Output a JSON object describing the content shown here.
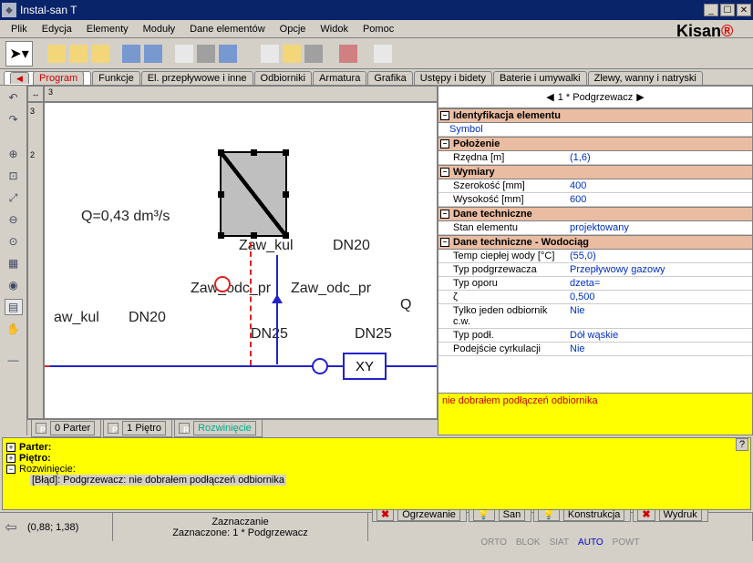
{
  "titlebar": {
    "title": "Instal-san T"
  },
  "menu": {
    "plik": "Plik",
    "edycja": "Edycja",
    "elementy": "Elementy",
    "moduly": "Moduły",
    "dane": "Dane elementów",
    "opcje": "Opcje",
    "widok": "Widok",
    "pomoc": "Pomoc"
  },
  "brand": "Kisan",
  "toptabs": {
    "program": "Program",
    "funkcje": "Funkcje",
    "elprzep": "El. przepływowe i inne",
    "odb": "Odbiorniki",
    "arm": "Armatura",
    "graf": "Grafika",
    "ustepy": "Ustępy i bidety",
    "baterie": "Baterie i umywalki",
    "zlewy": "Zlewy, wanny i natryski"
  },
  "canvas": {
    "q": "Q=0,43 dm³/s",
    "zaw_kul": "Zaw_kul",
    "dn20": "DN20",
    "aw_kul": "aw_kul",
    "zaw_odc_pr": "Zaw_odc_pr",
    "Zw_odc_pr": "Zaw_odc_pr",
    "dn25": "DN25",
    "Q": "Q",
    "xy": "XY",
    "ruler3": "3",
    "ruler2": "2"
  },
  "bottomtabs": {
    "t0": "0 Parter",
    "t1": "1 Piętro",
    "t2": "Rozwinięcie"
  },
  "prop": {
    "header": "1 * Podgrzewacz",
    "g1": "Identyfikacja elementu",
    "symbol": "Symbol",
    "g2": "Położenie",
    "rzedna_k": "Rzędna [m]",
    "rzedna_v": "(1,6)",
    "g3": "Wymiary",
    "szer_k": "Szerokość [mm]",
    "szer_v": "400",
    "wys_k": "Wysokość [mm]",
    "wys_v": "600",
    "g4": "Dane techniczne",
    "stan_k": "Stan elementu",
    "stan_v": "projektowany",
    "g5": "Dane techniczne - Wodociąg",
    "temp_k": "Temp ciepłej wody [°C]",
    "temp_v": "(55,0)",
    "typp_k": "Typ podgrzewacza",
    "typp_v": "Przepływowy gazowy",
    "typo_k": "Typ oporu",
    "typo_v": "dzeta=",
    "zeta_k": "ζ",
    "zeta_v": "0,500",
    "tylko_k": "Tylko jeden odbiornik c.w.",
    "tylko_v": "Nie",
    "typpodl_k": "Typ podł.",
    "typpodl_v": "Dół wąskie",
    "cyrk_k": "Podejście cyrkulacji",
    "cyrk_v": "Nie",
    "warn": "nie dobrałem podłączeń odbiornika"
  },
  "msg": {
    "parter": "Parter:",
    "pietro": "Piętro:",
    "rozw": "Rozwinięcie:",
    "err": "[Błąd]:  Podgrzewacz: nie dobrałem podłączeń odbiornika"
  },
  "status": {
    "coords": "(0,88; 1,38)",
    "zazn1": "Zaznaczanie",
    "zazn2": "Zaznaczone: 1 * Podgrzewacz",
    "ogrz": "Ogrzewanie",
    "san": "San",
    "konstr": "Konstrukcja",
    "wydr": "Wydruk",
    "orto": "ORTO",
    "blok": "BLOK",
    "siat": "SIAT",
    "auto": "AUTO",
    "powt": "POWT"
  }
}
